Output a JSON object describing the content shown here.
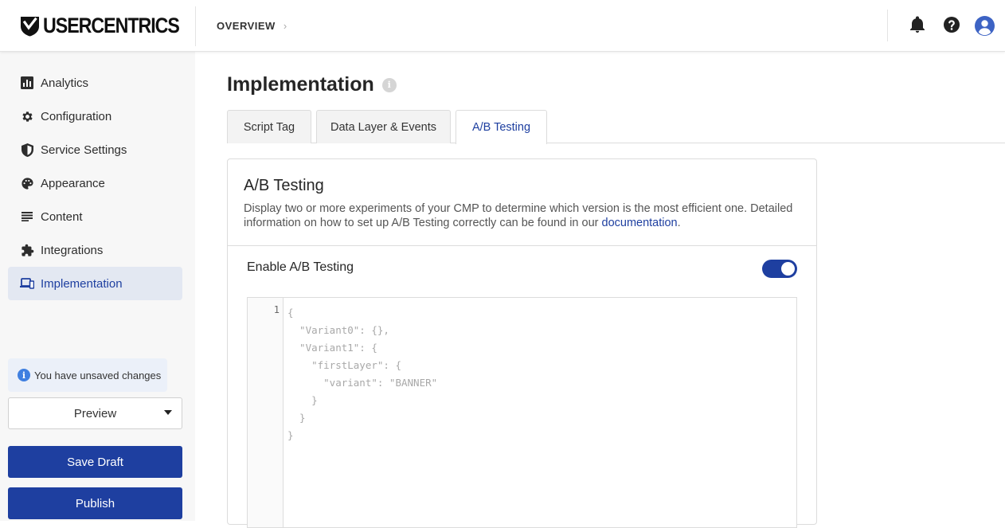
{
  "brand": {
    "name": "USERCENTRICS"
  },
  "header": {
    "breadcrumb": "OVERVIEW",
    "chevron": "›"
  },
  "sidebar": {
    "items": [
      {
        "label": "Analytics",
        "icon": "bar-chart-icon"
      },
      {
        "label": "Configuration",
        "icon": "gear-icon"
      },
      {
        "label": "Service Settings",
        "icon": "shield-icon"
      },
      {
        "label": "Appearance",
        "icon": "palette-icon"
      },
      {
        "label": "Content",
        "icon": "lines-icon"
      },
      {
        "label": "Integrations",
        "icon": "puzzle-icon"
      },
      {
        "label": "Implementation",
        "icon": "devices-icon",
        "active": true
      }
    ],
    "unsaved_notice": "You have unsaved changes",
    "preview_label": "Preview",
    "save_label": "Save Draft",
    "publish_label": "Publish"
  },
  "main": {
    "title": "Implementation",
    "tabs": [
      {
        "label": "Script Tag"
      },
      {
        "label": "Data Layer & Events"
      },
      {
        "label": "A/B Testing",
        "active": true
      }
    ],
    "card": {
      "title": "A/B Testing",
      "description_prefix": "Display two or more experiments of your CMP to determine which version is the most efficient one. Detailed information on how to set up A/B Testing correctly can be found in our ",
      "description_link": "documentation",
      "description_suffix": ".",
      "toggle_label": "Enable A/B Testing",
      "toggle_on": true,
      "editor": {
        "line_number": "1",
        "code": "{\n  \"Variant0\": {},\n  \"Variant1\": {\n    \"firstLayer\": {\n      \"variant\": \"BANNER\"\n    }\n  }\n}"
      }
    }
  },
  "colors": {
    "accent": "#1e3fa0",
    "active_nav_bg": "#e3e8f2",
    "info_blue": "#3f7fe0"
  }
}
